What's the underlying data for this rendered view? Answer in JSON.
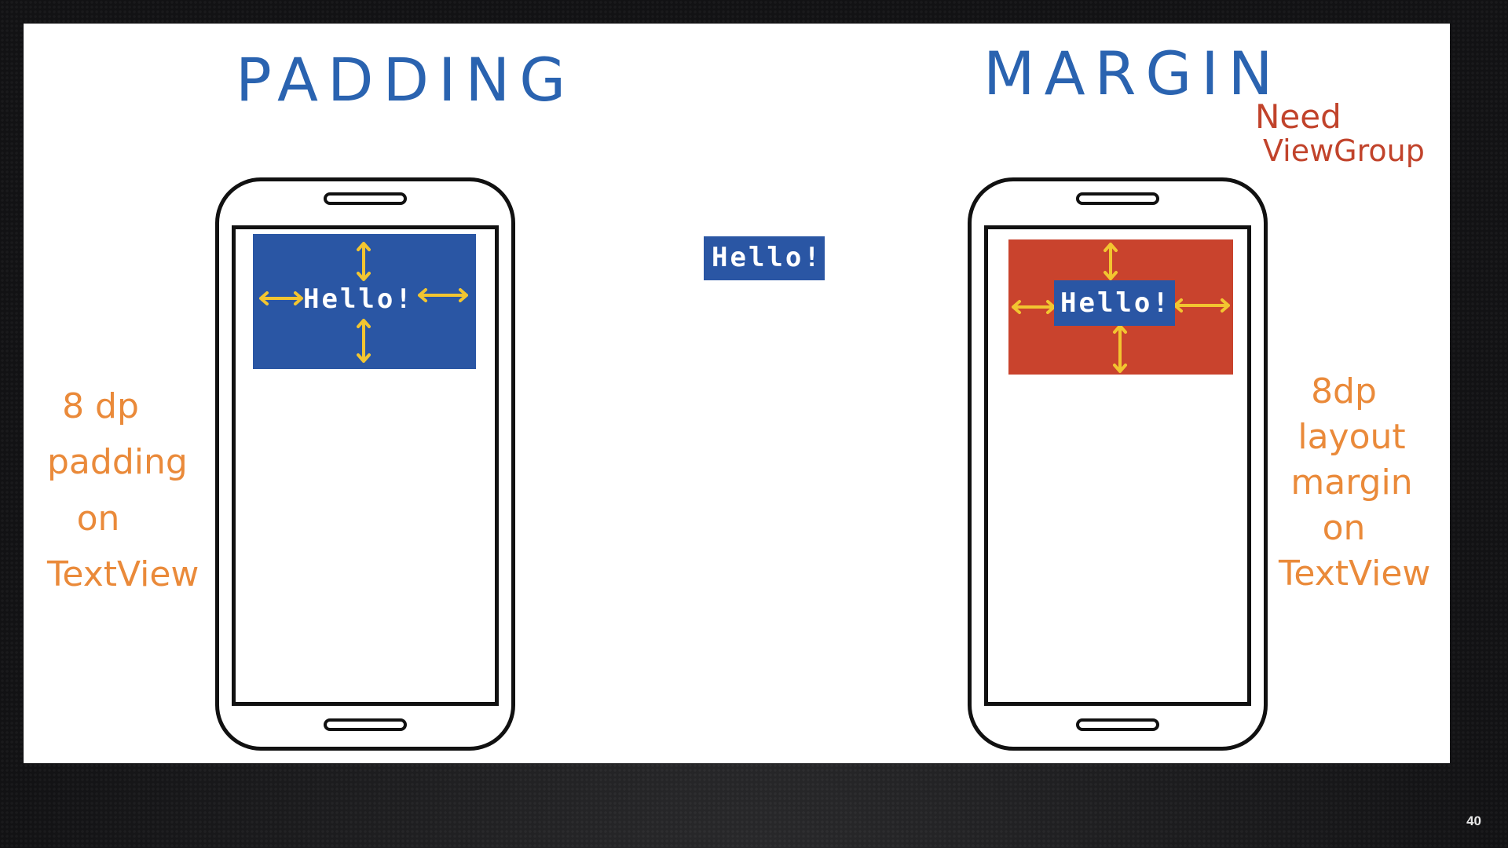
{
  "diagram": {
    "padding_title": "PADDING",
    "margin_title": "MARGIN",
    "center_label": "Hello!",
    "padding_box_label": "Hello!",
    "margin_box_label": "Hello!",
    "padding_note": {
      "line1": "8 dp",
      "line2": "padding",
      "line3": "on",
      "line4": "TextView"
    },
    "margin_note": {
      "line1": "8dp",
      "line2": "layout",
      "line3": "margin",
      "line4": "on",
      "line5": "TextView"
    },
    "viewgroup_note": {
      "line1": "Need",
      "line2": "ViewGroup"
    }
  },
  "slide_number": "40",
  "colors": {
    "title_blue": "#2a63b0",
    "textview_blue": "#2a56a4",
    "margin_red": "#c9432d",
    "arrow_yellow": "#f2c530",
    "note_orange": "#ea8a3a",
    "note_red": "#c1432b"
  }
}
